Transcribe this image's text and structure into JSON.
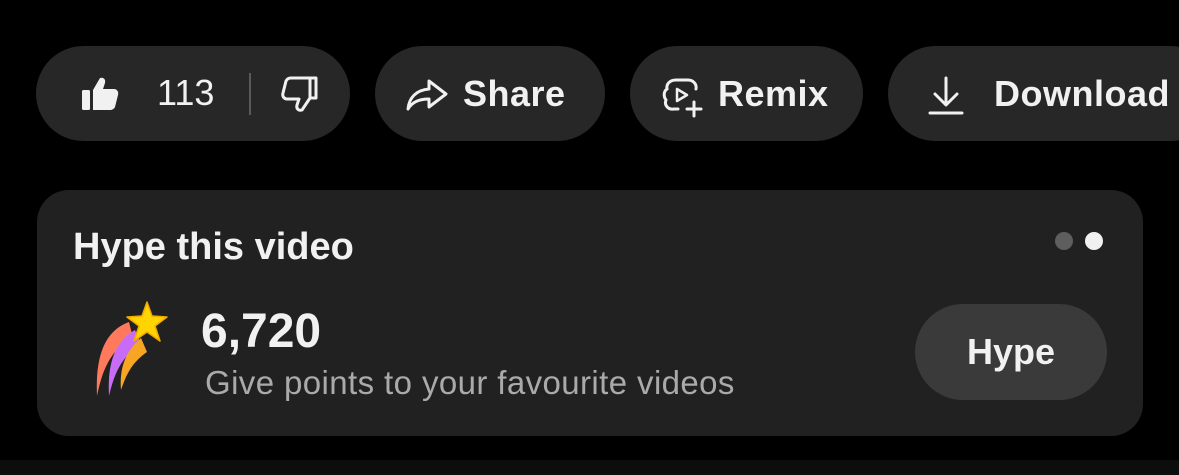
{
  "actions": {
    "like_count": "113",
    "share_label": "Share",
    "remix_label": "Remix",
    "download_label": "Download",
    "icons": {
      "like": "thumbs-up-icon",
      "dislike": "thumbs-down-icon",
      "share": "share-arrow-icon",
      "remix": "remix-icon",
      "download": "download-icon"
    }
  },
  "hype_card": {
    "title": "Hype this video",
    "points": "6,720",
    "subtitle": "Give points to your favourite videos",
    "button_label": "Hype",
    "icon": "shooting-star-icon",
    "pager": {
      "count": 2,
      "active_index": 1
    }
  },
  "colors": {
    "background": "#000000",
    "pill_background": "#272727",
    "card_background": "#212121",
    "button_background": "#3a3a3a",
    "text_primary": "#f1f1f1",
    "text_secondary": "#aaaaaa"
  }
}
